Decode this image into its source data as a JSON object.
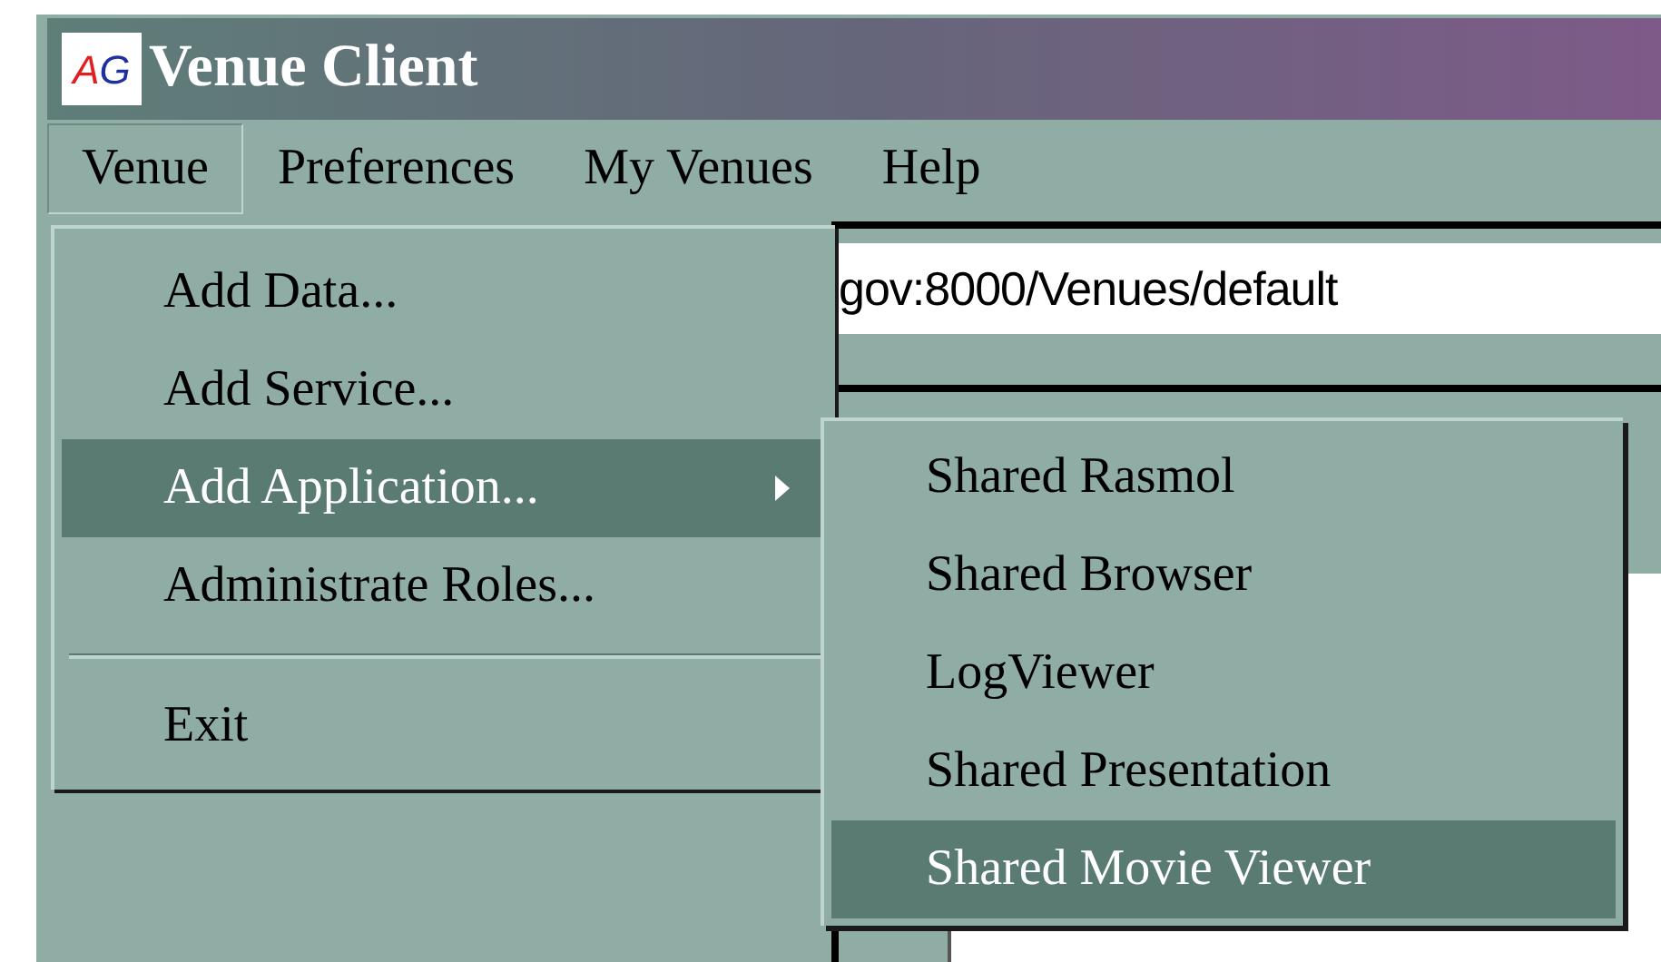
{
  "window": {
    "title": "Venue Client",
    "logo": [
      {
        "text": "A",
        "color": "#e02020"
      },
      {
        "text": "G",
        "color": "#2030a0"
      }
    ]
  },
  "menu_bar": [
    {
      "label": "Venue",
      "selected": true
    },
    {
      "label": "Preferences",
      "selected": false
    },
    {
      "label": "My Venues",
      "selected": false
    },
    {
      "label": "Help",
      "selected": false
    }
  ],
  "url_field": {
    "value": "gov:8000/Venues/default"
  },
  "venue_menu": [
    {
      "kind": "item",
      "label": "Add Data...",
      "selected": false,
      "has_submenu": false
    },
    {
      "kind": "item",
      "label": "Add Service...",
      "selected": false,
      "has_submenu": false
    },
    {
      "kind": "item",
      "label": "Add Application...",
      "selected": true,
      "has_submenu": true
    },
    {
      "kind": "item",
      "label": "Administrate Roles...",
      "selected": false,
      "has_submenu": false
    },
    {
      "kind": "separator"
    },
    {
      "kind": "item",
      "label": "Exit",
      "selected": false,
      "has_submenu": false
    }
  ],
  "application_submenu": [
    {
      "label": "Shared Rasmol",
      "selected": false
    },
    {
      "label": "Shared Browser",
      "selected": false
    },
    {
      "label": "LogViewer",
      "selected": false
    },
    {
      "label": "Shared Presentation",
      "selected": false
    },
    {
      "label": "Shared Movie Viewer",
      "selected": true
    }
  ]
}
